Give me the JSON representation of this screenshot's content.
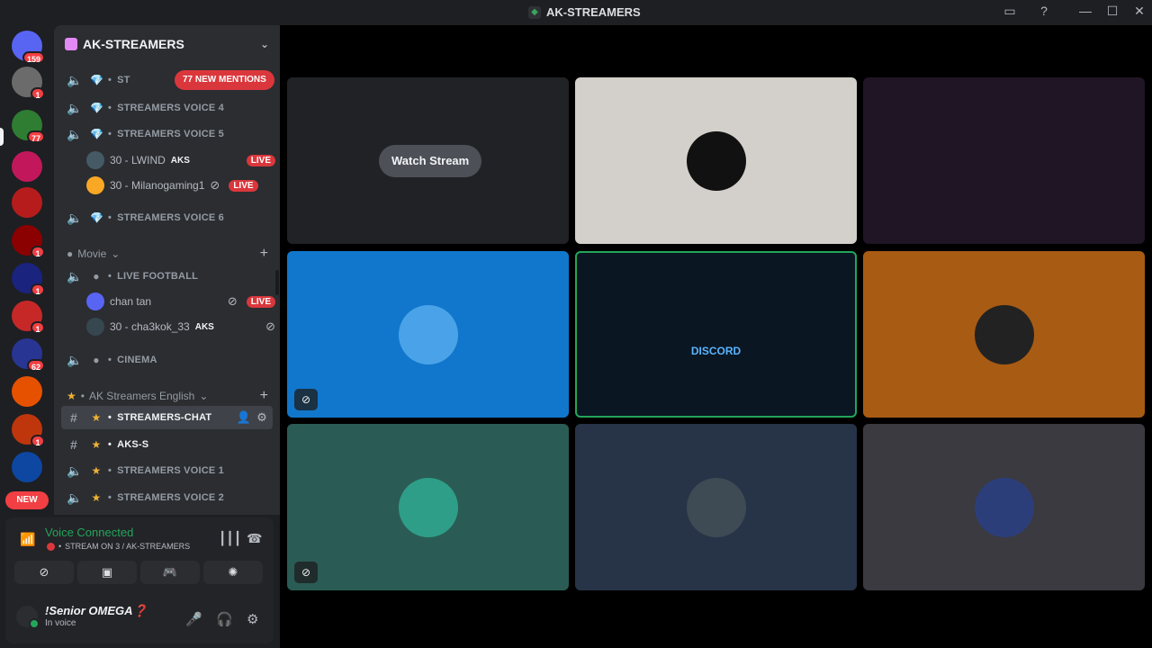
{
  "window": {
    "title": "AK-STREAMERS",
    "controls": [
      "—",
      "☐",
      "✕"
    ]
  },
  "servers": [
    {
      "name": "home",
      "badge": "159",
      "color": "#5865f2"
    },
    {
      "name": "server-2",
      "badge": "1",
      "color": "#6b6b6b"
    },
    {
      "name": "server-3",
      "badge": "77",
      "color": "#2e7d32"
    },
    {
      "name": "server-4",
      "badge": "",
      "color": "#c2185b"
    },
    {
      "name": "server-5",
      "badge": "",
      "color": "#b71c1c"
    },
    {
      "name": "server-6",
      "badge": "1",
      "color": "#8b0000"
    },
    {
      "name": "server-7",
      "badge": "1",
      "color": "#1a237e"
    },
    {
      "name": "server-8",
      "badge": "1",
      "color": "#c62828"
    },
    {
      "name": "server-9",
      "badge": "62",
      "color": "#283593"
    },
    {
      "name": "server-10",
      "badge": "",
      "color": "#e65100"
    },
    {
      "name": "server-11",
      "badge": "1",
      "color": "#bf360c"
    },
    {
      "name": "server-12",
      "badge": "",
      "color": "#0d47a1"
    },
    {
      "name": "server-13",
      "badge": "",
      "color": "#4e342e"
    }
  ],
  "new_label": "NEW",
  "guild": {
    "name": "AK-STREAMERS"
  },
  "mentions_label": "77 NEW MENTIONS",
  "channels": {
    "c1": {
      "name": "ST",
      "emoji": "💎"
    },
    "c2": {
      "name": "STREAMERS VOICE 4",
      "emoji": "💎"
    },
    "c3": {
      "name": "STREAMERS VOICE 5",
      "emoji": "💎"
    },
    "c4": {
      "name": "STREAMERS VOICE 6",
      "emoji": "💎"
    },
    "movie_category": "Movie",
    "c5": {
      "name": "LIVE FOOTBALL"
    },
    "c6": {
      "name": "CINEMA"
    },
    "english_category": "AK Streamers English",
    "c7": {
      "name": "STREAMERS-CHAT",
      "emoji": "★"
    },
    "c8": {
      "name": "AKS-S",
      "emoji": "★"
    },
    "c9": {
      "name": "STREAMERS VOICE 1",
      "emoji": "★"
    },
    "c10": {
      "name": "STREAMERS VOICE 2",
      "emoji": "★"
    }
  },
  "voice_users": {
    "u1": {
      "name": "30 - LWIND",
      "tag": "AKS",
      "live": ""
    },
    "u2": {
      "name": "30 - Milanogaming1",
      "tag": "",
      "live": "LIVE"
    },
    "u3": {
      "name": "chan tan",
      "tag": "",
      "live": "LIVE"
    },
    "u4": {
      "name": "30 - cha3kok_33",
      "tag": "AKS",
      "live": ""
    }
  },
  "live_label": "LIVE",
  "voice_panel": {
    "status": "Voice Connected",
    "details": "STREAM ON 3 / AK-STREAMERS"
  },
  "user": {
    "name": "!Senior OMEGA❓",
    "status": "In voice"
  },
  "tiles": {
    "watch_stream": "Watch Stream",
    "discord_text": "DISCORD",
    "colors": [
      "#202225",
      "#d3d0cb",
      "#1f1525",
      "#1177cc",
      "#0a1622",
      "#a85b13",
      "#2a5c55",
      "#273447",
      "#3b3a40"
    ]
  }
}
